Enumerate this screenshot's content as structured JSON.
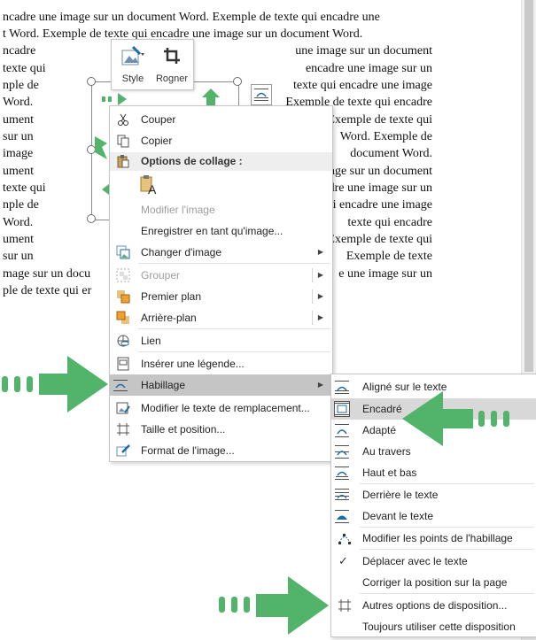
{
  "document": {
    "lines": [
      {
        "left": "ncadre une image sur un document Word. Exemple de texte qui encadre une",
        "right": ""
      },
      {
        "left": "t Word. Exemple de texte qui encadre une image sur un document Word.",
        "right": ""
      },
      {
        "left": "ncadre",
        "right": "une image sur un document"
      },
      {
        "left": "texte qui",
        "right": "encadre une image sur un"
      },
      {
        "left": "nple de",
        "right": "texte qui encadre une image"
      },
      {
        "left": "Word.",
        "right": "Exemple de texte qui encadre"
      },
      {
        "left": "ument",
        "right": "Exemple de texte qui"
      },
      {
        "left": "sur un",
        "right": "Word. Exemple de"
      },
      {
        "left": "image",
        "right": "document Word."
      },
      {
        "left": "ument",
        "right": "une image sur un document"
      },
      {
        "left": "texte qui",
        "right": "encadre une image sur un"
      },
      {
        "left": "nple de",
        "right": "texte qui encadre une image"
      },
      {
        "left": "Word.",
        "right": "texte qui encadre"
      },
      {
        "left": "ument",
        "right": "Exemple de texte qui"
      },
      {
        "left": "sur un",
        "right": "Exemple de texte"
      },
      {
        "left": "mage sur un docu",
        "right": "e une image sur un"
      },
      {
        "left": "ple de texte qui er",
        "right": ""
      }
    ]
  },
  "mini_toolbar": {
    "style_label": "Style",
    "crop_label": "Rogner"
  },
  "context_menu": {
    "cut": "Couper",
    "copy": "Copier",
    "paste_options_header": "Options de collage :",
    "edit_image": "Modifier l'image",
    "save_as_image": "Enregistrer en tant qu'image...",
    "change_image": "Changer d'image",
    "group": "Grouper",
    "bring_front": "Premier plan",
    "send_back": "Arrière-plan",
    "link": "Lien",
    "insert_caption": "Insérer une légende...",
    "wrap_text": "Habillage",
    "edit_alt_text": "Modifier le texte de remplacement...",
    "size_position": "Taille et position...",
    "format_image": "Format de l'image..."
  },
  "wrap_submenu": {
    "inline": "Aligné sur le texte",
    "square": "Encadré",
    "tight": "Adapté",
    "through": "Au travers",
    "top_bottom": "Haut et bas",
    "behind": "Derrière le texte",
    "front": "Devant le texte",
    "edit_points": "Modifier les points de l'habillage",
    "move_with_text": "Déplacer avec le texte",
    "fix_position": "Corriger la position sur la page",
    "more_options": "Autres options de disposition...",
    "set_default": "Toujours utiliser cette disposition"
  },
  "colors": {
    "annotation_arrow": "#52b36b",
    "highlight": "#c5c5c5",
    "icon_blue": "#1e6aa8"
  }
}
